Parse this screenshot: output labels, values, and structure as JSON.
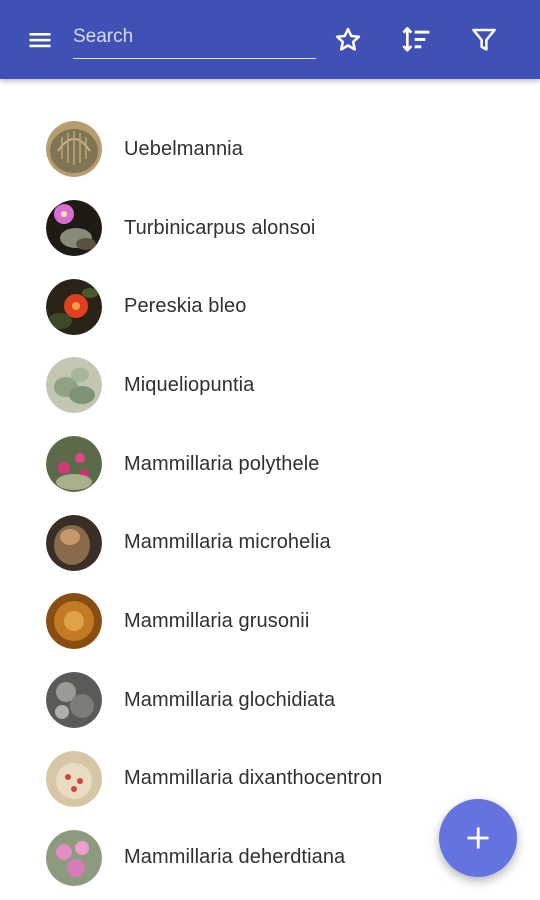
{
  "app_bar": {
    "background": "#3f51b5",
    "menu_icon": "menu-icon",
    "search": {
      "placeholder": "Search",
      "value": ""
    },
    "actions": [
      {
        "name": "favorites",
        "icon": "star-outline-icon"
      },
      {
        "name": "sort",
        "icon": "sort-icon"
      },
      {
        "name": "filter",
        "icon": "filter-icon"
      }
    ]
  },
  "list": {
    "items": [
      {
        "label": "Uebelmannia"
      },
      {
        "label": "Turbinicarpus alonsoi"
      },
      {
        "label": "Pereskia bleo"
      },
      {
        "label": "Miqueliopuntia"
      },
      {
        "label": "Mammillaria polythele"
      },
      {
        "label": "Mammillaria microhelia"
      },
      {
        "label": "Mammillaria grusonii"
      },
      {
        "label": "Mammillaria glochidiata"
      },
      {
        "label": "Mammillaria dixanthocentron"
      },
      {
        "label": "Mammillaria deherdtiana"
      }
    ]
  },
  "fab": {
    "icon": "plus-icon",
    "color": "#6573e0"
  }
}
